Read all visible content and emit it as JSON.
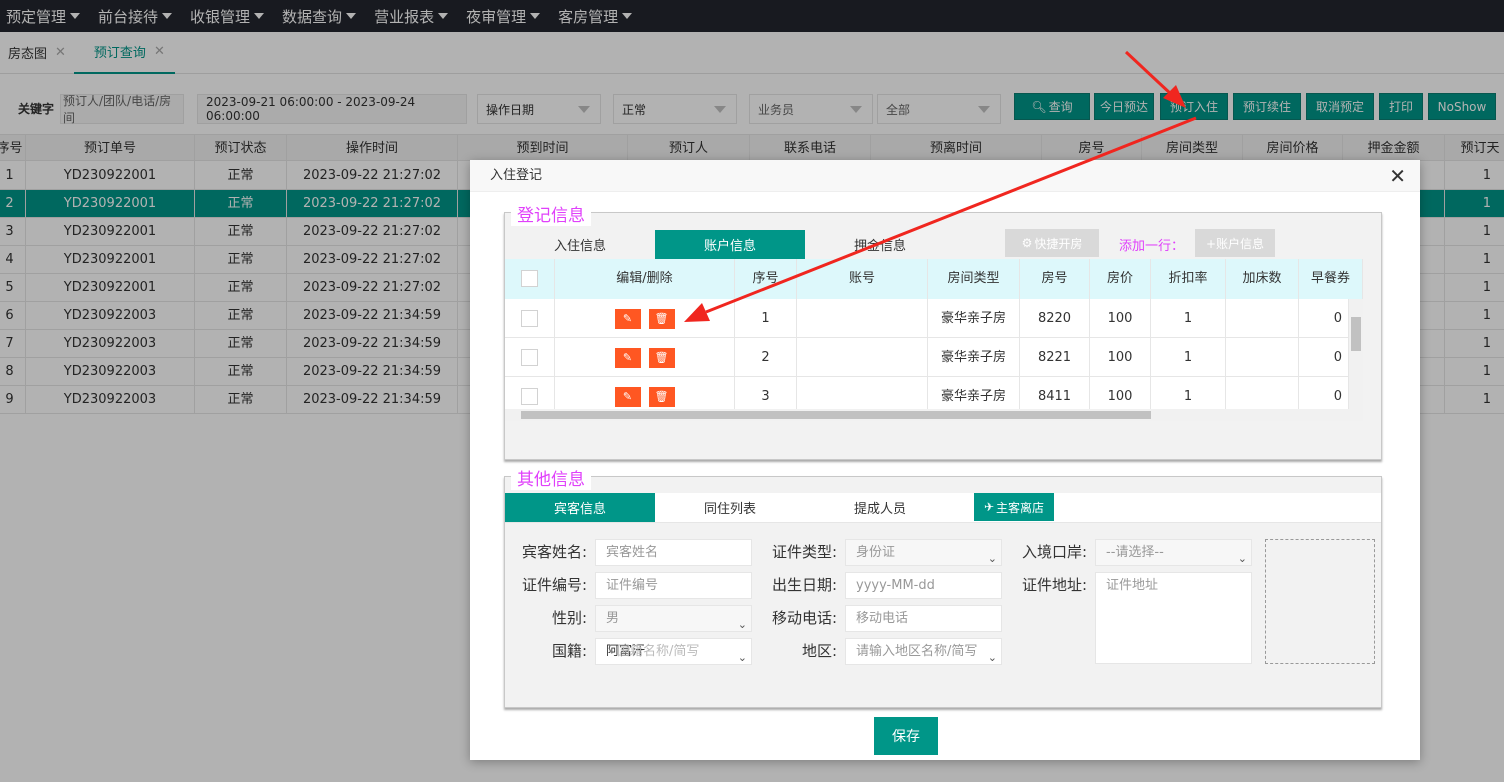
{
  "topmenu": [
    {
      "label": "预定管理"
    },
    {
      "label": "前台接待"
    },
    {
      "label": "收银管理"
    },
    {
      "label": "数据查询"
    },
    {
      "label": "营业报表"
    },
    {
      "label": "夜审管理"
    },
    {
      "label": "客房管理"
    }
  ],
  "tabs": [
    {
      "label": "房态图",
      "close": "✕"
    },
    {
      "label": "预订查询",
      "close": "✕"
    }
  ],
  "filter": {
    "keyword_label": "关键字",
    "keyword_placeholder": "预订人/团队/电话/房间",
    "date_range": "2023-09-21 06:00:00 - 2023-09-24 06:00:00",
    "date_type": "操作日期",
    "status": "正常",
    "salesman": "业务员",
    "scope": "全部",
    "buttons": {
      "query": "查询",
      "today": "今日预达",
      "checkin": "预订入住",
      "extend": "预订续住",
      "cancel": "取消预定",
      "print": "打印",
      "noshow": "NoShow"
    }
  },
  "table": {
    "headers": [
      "序号",
      "预订单号",
      "预订状态",
      "操作时间",
      "预到时间",
      "预订人",
      "联系电话",
      "预离时间",
      "房号",
      "房间类型",
      "房间价格",
      "押金金额",
      "预订天"
    ],
    "rows": [
      {
        "no": "1",
        "order": "YD230922001",
        "status": "正常",
        "time": "2023-09-22 21:27:02",
        "days": "1"
      },
      {
        "no": "2",
        "order": "YD230922001",
        "status": "正常",
        "time": "2023-09-22 21:27:02",
        "days": "1"
      },
      {
        "no": "3",
        "order": "YD230922001",
        "status": "正常",
        "time": "2023-09-22 21:27:02",
        "days": "1"
      },
      {
        "no": "4",
        "order": "YD230922001",
        "status": "正常",
        "time": "2023-09-22 21:27:02",
        "days": "1"
      },
      {
        "no": "5",
        "order": "YD230922001",
        "status": "正常",
        "time": "2023-09-22 21:27:02",
        "days": "1"
      },
      {
        "no": "6",
        "order": "YD230922003",
        "status": "正常",
        "time": "2023-09-22 21:34:59",
        "days": "1"
      },
      {
        "no": "7",
        "order": "YD230922003",
        "status": "正常",
        "time": "2023-09-22 21:34:59",
        "days": "1"
      },
      {
        "no": "8",
        "order": "YD230922003",
        "status": "正常",
        "time": "2023-09-22 21:34:59",
        "days": "1"
      },
      {
        "no": "9",
        "order": "YD230922003",
        "status": "正常",
        "time": "2023-09-22 21:34:59",
        "days": "1"
      }
    ]
  },
  "dialog": {
    "title": "入住登记",
    "close": "✕",
    "reg": {
      "legend": "登记信息",
      "tabs": [
        "入住信息",
        "账户信息",
        "押金信息"
      ],
      "quick_open": "快捷开房",
      "add_row_label": "添加一行：",
      "add_account": "+账户信息",
      "grid_headers": [
        "编辑/删除",
        "序号",
        "账号",
        "房间类型",
        "房号",
        "房价",
        "折扣率",
        "加床数",
        "早餐券"
      ],
      "grid_rows": [
        {
          "seq": "1",
          "account": "",
          "roomtype": "豪华亲子房",
          "room": "8220",
          "price": "100",
          "discount": "1",
          "extra": "",
          "breakfast": "0"
        },
        {
          "seq": "2",
          "account": "",
          "roomtype": "豪华亲子房",
          "room": "8221",
          "price": "100",
          "discount": "1",
          "extra": "",
          "breakfast": "0"
        },
        {
          "seq": "3",
          "account": "",
          "roomtype": "豪华亲子房",
          "room": "8411",
          "price": "100",
          "discount": "1",
          "extra": "",
          "breakfast": "0"
        }
      ]
    },
    "other": {
      "legend": "其他信息",
      "tabs": [
        "宾客信息",
        "同住列表",
        "提成人员"
      ],
      "main_leave": "主客离店",
      "fields": {
        "guest_name_label": "宾客姓名:",
        "guest_name_ph": "宾客姓名",
        "id_type_label": "证件类型:",
        "id_type_val": "身份证",
        "entry_port_label": "入境口岸:",
        "entry_port_val": "--请选择--",
        "id_no_label": "证件编号:",
        "id_no_ph": "证件编号",
        "birth_label": "出生日期:",
        "birth_ph": "yyyy-MM-dd",
        "id_addr_label": "证件地址:",
        "id_addr_ph": "证件地址",
        "gender_label": "性别:",
        "gender_val": "男",
        "mobile_label": "移动电话:",
        "mobile_ph": "移动电话",
        "nation_label": "国籍:",
        "nation_val": "阿富汗",
        "nation_ph": "国籍名称/简写",
        "region_label": "地区:",
        "region_ph": "请输入地区名称/简写"
      }
    },
    "save": "保存"
  },
  "colors": {
    "accent": "#009688",
    "danger": "#ff5722",
    "legend": "#e040fb",
    "arrow": "#f0261f"
  }
}
